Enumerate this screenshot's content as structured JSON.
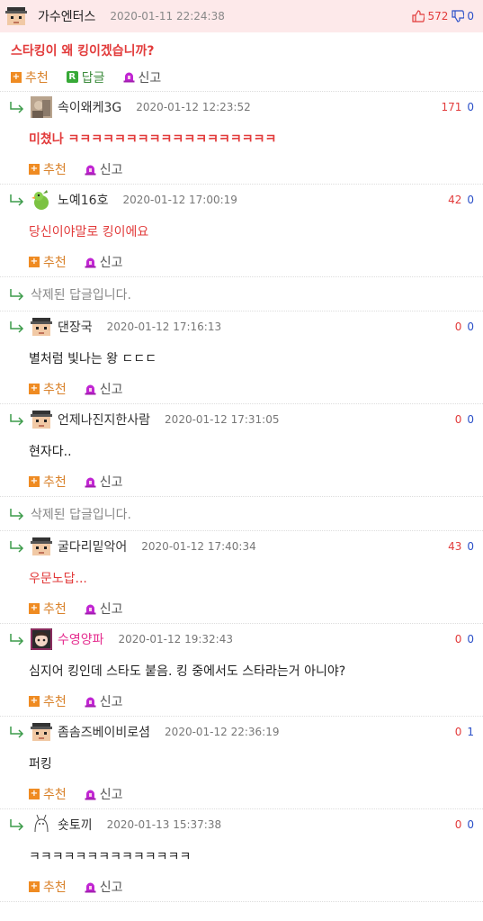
{
  "post": {
    "author": "가수엔터스",
    "date": "2020-01-11 22:24:38",
    "upvotes": "572",
    "downvotes": "0",
    "title": "스타킹이 왜 킹이겠습니까?",
    "actions": {
      "recommend": "추천",
      "reply": "답글",
      "report": "신고"
    }
  },
  "comment_actions": {
    "recommend": "추천",
    "report": "신고"
  },
  "deleted_text": "삭제된 답글입니다.",
  "comments": [
    {
      "author": "속이왜케3G",
      "date": "2020-01-12 12:23:52",
      "up": "171",
      "down": "0",
      "text": "미쳤나 ㅋㅋㅋㅋㅋㅋㅋㅋㅋㅋㅋㅋㅋㅋㅋㅋㅋㅋ",
      "avatar": "photo-avatar-icon"
    },
    {
      "author": "노예16호",
      "date": "2020-01-12 17:00:19",
      "up": "42",
      "down": "0",
      "text": "당신이야말로 킹이에요",
      "avatar": "parrot-avatar-icon"
    },
    {
      "author": "댄장국",
      "date": "2020-01-12 17:16:13",
      "up": "0",
      "down": "0",
      "text": "별처럼 빛나는 왕 ㄷㄷㄷ",
      "avatar": "pixel-face-avatar-icon"
    },
    {
      "author": "언제나진지한사람",
      "date": "2020-01-12 17:31:05",
      "up": "0",
      "down": "0",
      "text": "현자다..",
      "avatar": "pixel-face-avatar-icon"
    },
    {
      "author": "굴다리밑악어",
      "date": "2020-01-12 17:40:34",
      "up": "43",
      "down": "0",
      "text": "우문노답...",
      "avatar": "pixel-face-avatar-icon"
    },
    {
      "author": "수영양파",
      "date": "2020-01-12 19:32:43",
      "up": "0",
      "down": "0",
      "text": "심지어 킹인데 스타도 붙음. 킹 중에서도 스타라는거 아니야?",
      "avatar": "anime-avatar-icon"
    },
    {
      "author": "좀솜즈베이비로셤",
      "date": "2020-01-12 22:36:19",
      "up": "0",
      "down": "1",
      "text": "퍼킹",
      "avatar": "pixel-face-avatar-icon"
    },
    {
      "author": "숏토끼",
      "date": "2020-01-13 15:37:38",
      "up": "0",
      "down": "0",
      "text": "ㅋㅋㅋㅋㅋㅋㅋㅋㅋㅋㅋㅋㅋㅋ",
      "avatar": "sketch-avatar-icon"
    }
  ],
  "colors": {
    "up": "#e23b3b",
    "down": "#2b50c8",
    "header_bg": "#fde9ea",
    "accent_orange": "#ef8b22",
    "accent_green": "#37a937"
  }
}
